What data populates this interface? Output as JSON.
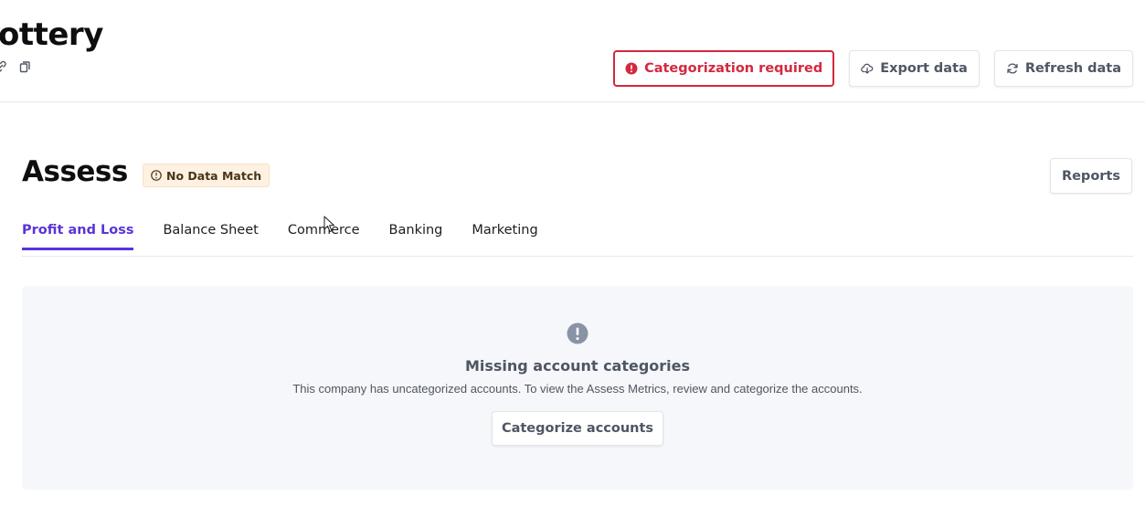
{
  "header": {
    "company_title": "ottery",
    "icons": [
      "link-icon",
      "copy-icon"
    ],
    "actions": {
      "categorization_label": "Categorization required",
      "export_label": "Export data",
      "refresh_label": "Refresh data"
    }
  },
  "section": {
    "title": "Assess",
    "badge": "No Data Match",
    "reports_label": "Reports"
  },
  "tabs": [
    {
      "label": "Profit and Loss",
      "active": true
    },
    {
      "label": "Balance Sheet",
      "active": false
    },
    {
      "label": "Commerce",
      "active": false
    },
    {
      "label": "Banking",
      "active": false
    },
    {
      "label": "Marketing",
      "active": false
    }
  ],
  "empty_state": {
    "icon": "alert-circle-icon",
    "title": "Missing account categories",
    "description": "This company has uncategorized accounts. To view the Assess Metrics, review and categorize the accounts.",
    "button_label": "Categorize accounts"
  },
  "colors": {
    "accent": "#5a35d6",
    "danger": "#d4283e",
    "badge_bg": "#fdf1e1",
    "panel_bg": "#f5f7fa"
  }
}
